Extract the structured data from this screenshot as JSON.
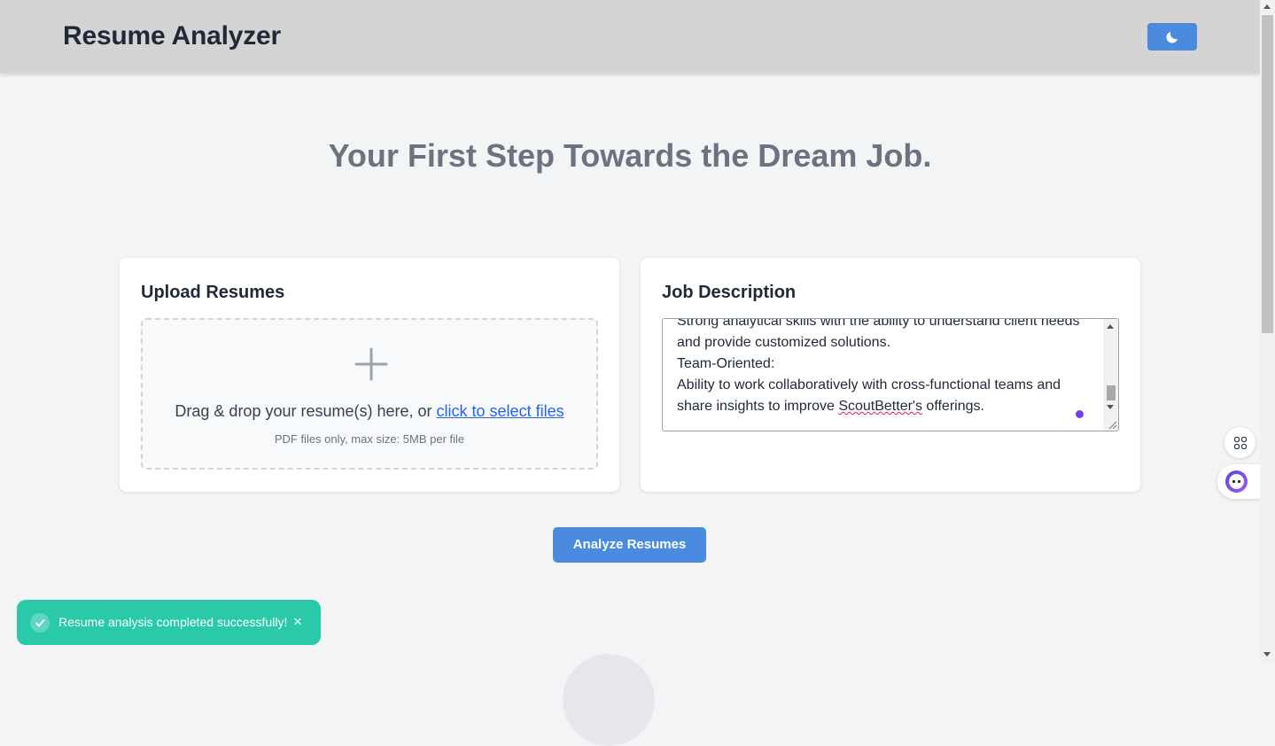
{
  "header": {
    "title": "Resume Analyzer",
    "theme_toggle_icon": "moon-icon",
    "accent_color": "#4a8be0"
  },
  "hero": {
    "headline": "Your First Step Towards the Dream Job."
  },
  "upload_card": {
    "title": "Upload Resumes",
    "drop_text_prefix": "Drag & drop your resume(s) here, or ",
    "drop_link": "click to select files",
    "hint": "PDF files only, max size: 5MB per file",
    "icon": "plus-icon"
  },
  "job_card": {
    "title": "Job Description",
    "text_lines": [
      "Strong analytical skills with the ability to understand client needs",
      "and provide customized solutions.",
      "Team-Oriented:",
      "Ability to work collaboratively with cross-functional teams and"
    ],
    "last_line_prefix": "share insights to improve ",
    "last_line_misspelled": "ScoutBetter's",
    "last_line_suffix": " offerings."
  },
  "actions": {
    "analyze_label": "Analyze Resumes"
  },
  "toast": {
    "message": "Resume analysis completed successfully!",
    "close_label": "×",
    "color": "#2ac9a7"
  },
  "floating": {
    "apps_icon": "grid-icon",
    "assistant_icon": "assistant-face-icon"
  }
}
